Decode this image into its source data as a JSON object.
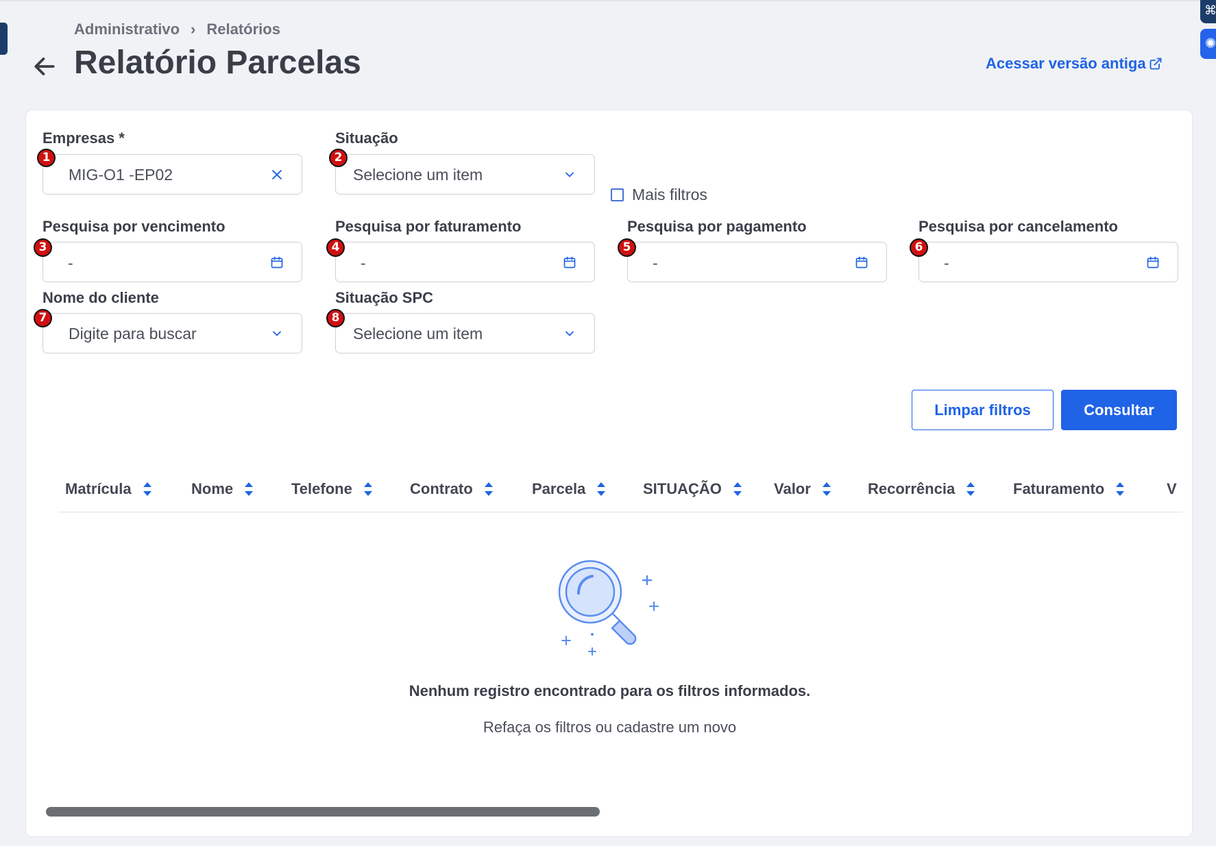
{
  "breadcrumb": {
    "items": [
      "Administrativo",
      "Relatórios"
    ],
    "separator": "›"
  },
  "header": {
    "title": "Relatório Parcelas",
    "old_version_link": "Acessar versão antiga"
  },
  "filters": {
    "empresas": {
      "label": "Empresas *",
      "value": "MIG-O1 -EP02",
      "badge": "1"
    },
    "situacao": {
      "label": "Situação",
      "placeholder": "Selecione um item",
      "badge": "2"
    },
    "mais_filtros": {
      "label": "Mais filtros",
      "checked": false
    },
    "vencimento": {
      "label": "Pesquisa por vencimento",
      "value": "-",
      "badge": "3"
    },
    "faturamento": {
      "label": "Pesquisa por faturamento",
      "value": "-",
      "badge": "4"
    },
    "pagamento": {
      "label": "Pesquisa por pagamento",
      "value": "-",
      "badge": "5"
    },
    "cancelamento": {
      "label": "Pesquisa por cancelamento",
      "value": "-",
      "badge": "6"
    },
    "cliente": {
      "label": "Nome do cliente",
      "placeholder": "Digite para buscar",
      "badge": "7"
    },
    "situacao_spc": {
      "label": "Situação SPC",
      "placeholder": "Selecione um item",
      "badge": "8"
    }
  },
  "actions": {
    "clear": "Limpar filtros",
    "submit": "Consultar"
  },
  "table": {
    "columns": [
      "Matrícula",
      "Nome",
      "Telefone",
      "Contrato",
      "Parcela",
      "SITUAÇÃO",
      "Valor",
      "Recorrência",
      "Faturamento",
      "V"
    ]
  },
  "empty": {
    "title": "Nenhum registro encontrado para os filtros informados.",
    "subtitle": "Refaça os filtros ou cadastre um novo"
  },
  "colors": {
    "primary": "#1f63e6",
    "badge": "#d01010",
    "nav_dark": "#1c3d6a"
  },
  "icons": [
    "arrow-left-icon",
    "external-link-icon",
    "close-icon",
    "chevron-down-icon",
    "calendar-icon",
    "sort-icon",
    "magnifier-illustration"
  ]
}
